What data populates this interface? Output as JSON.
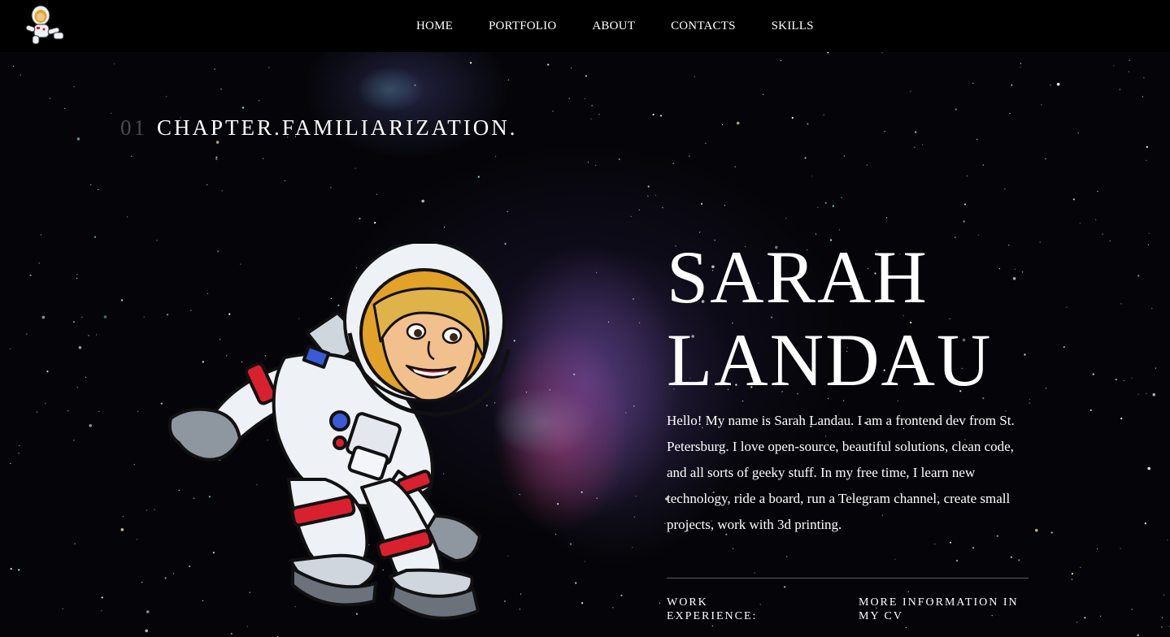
{
  "nav": {
    "logo_icon": "astronaut-avatar-icon",
    "links": [
      "HOME",
      "PORTFOLIO",
      "ABOUT",
      "CONTACTS",
      "SKILLS"
    ]
  },
  "chapter": {
    "number": "01",
    "title": "CHAPTER.FAMILIARIZATION."
  },
  "hero": {
    "name_line1": "SARAH",
    "name_line2": "LANDAU",
    "bio": "Hello! My name is Sarah Landau. I am a frontend dev from St. Petersburg. I love open-source, beautiful solutions, clean code, and all sorts of geeky stuff. In my free time, I learn new technology, ride a board, run a Telegram channel, create small projects, work with 3d printing.",
    "work_label": "WORK EXPERIENCE:",
    "cv_link": "MORE INFORMATION IN MY CV",
    "illustration_icon": "astronaut-illustration-icon"
  },
  "colors": {
    "background": "#050509",
    "navbar": "#000000",
    "text": "#ffffff",
    "chapter_number": "#4a4a4a"
  }
}
